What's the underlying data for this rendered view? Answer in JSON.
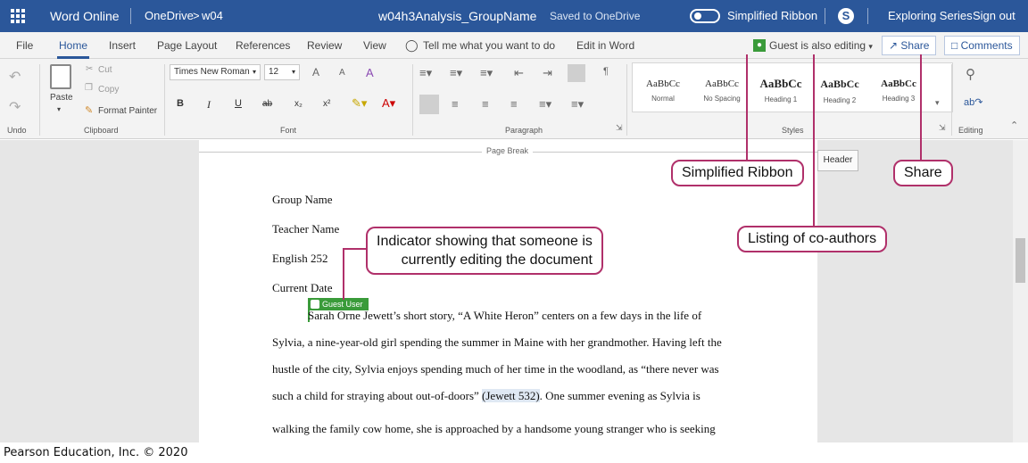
{
  "titlebar": {
    "app_name": "Word Online",
    "breadcrumb_root": "OneDrive",
    "breadcrumb_sep": ">",
    "breadcrumb_folder": "w04",
    "doc_title": "w04h3Analysis_GroupName",
    "save_status": "Saved to OneDrive",
    "simplified_ribbon_label": "Simplified Ribbon",
    "skype_glyph": "S",
    "user_name": "Exploring Series",
    "sign_out": "Sign out",
    "bg_color": "#2b579a"
  },
  "menu": {
    "tabs": [
      "File",
      "Home",
      "Insert",
      "Page Layout",
      "References",
      "Review",
      "View"
    ],
    "active_tab": "Home",
    "tell_me": "Tell me what you want to do",
    "edit_in_word": "Edit in Word",
    "coauthor_status": "Guest is also editing",
    "share": "Share",
    "comments": "Comments"
  },
  "ribbon": {
    "undo_group": "Undo",
    "clipboard": {
      "paste": "Paste",
      "cut": "Cut",
      "copy": "Copy",
      "format_painter": "Format Painter",
      "group_label": "Clipboard"
    },
    "font": {
      "family": "Times New Roman",
      "size": "12",
      "group_label": "Font",
      "bold": "B",
      "italic": "I",
      "underline": "U",
      "strike": "ab",
      "subscript": "x₂",
      "superscript": "x²",
      "grow": "A",
      "shrink": "A",
      "clear": "A"
    },
    "paragraph": {
      "group_label": "Paragraph"
    },
    "styles": {
      "group_label": "Styles",
      "items": [
        {
          "sample": "AaBbCc",
          "name": "Normal"
        },
        {
          "sample": "AaBbCc",
          "name": "No Spacing"
        },
        {
          "sample": "AaBbCc",
          "name": "Heading 1"
        },
        {
          "sample": "AaBbCc",
          "name": "Heading 2"
        },
        {
          "sample": "AaBbCc",
          "name": "Heading 3"
        }
      ]
    },
    "editing": {
      "group_label": "Editing"
    }
  },
  "document": {
    "page_break_label": "Page Break",
    "header_chip": "Header",
    "lines": [
      "Group Name",
      "Teacher Name",
      "English 252",
      "Current Date"
    ],
    "guest_flag": "Guest User",
    "paragraph_lines": [
      "Sarah Orne Jewett’s short story, “A White Heron” centers on a few days in the life of",
      "Sylvia, a nine-year-old girl spending the summer in Maine with her grandmother. Having left the",
      "hustle of the city, Sylvia enjoys spending much of her time in the woodland, as “there never was",
      "walking the family cow home, she is approached by a handsome young stranger who is seeking"
    ],
    "line4_pre": "such a child for straying about out-of-doors”",
    "line4_cite": "(Jewett 532)",
    "line4_post": ". One summer evening as Sylvia is"
  },
  "callouts": {
    "simplified_ribbon": "Simplified Ribbon",
    "share": "Share",
    "coauthors": "Listing of co-authors",
    "indicator_line1": "Indicator showing that someone is",
    "indicator_line2": "currently editing the document",
    "border_color": "#b0306a"
  },
  "footer": {
    "copyright": "Pearson Education, Inc. © 2020"
  }
}
